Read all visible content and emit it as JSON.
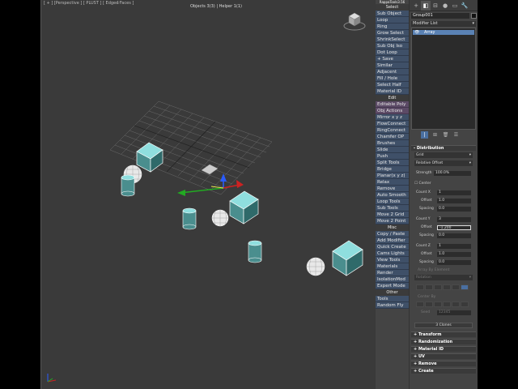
{
  "viewport": {
    "label": "[ + ] [Perspective ] [ PLUST ] [ Edged Faces ]",
    "close_glyph": "☆",
    "stats": "Objects 3(3) | Helper 1(1)"
  },
  "quad_menu": {
    "title": "RappaTools3.56",
    "groups": [
      {
        "header": "Select",
        "items": [
          {
            "label": "Sub Object",
            "style": "blue"
          },
          {
            "label": "Loop",
            "style": "blue"
          },
          {
            "label": "Ring",
            "style": "blue"
          },
          {
            "label": "Grow Select",
            "style": "blue"
          },
          {
            "label": "ShrinkSelect",
            "style": "blue"
          },
          {
            "label": "Sub Obj Iso",
            "style": "blue"
          },
          {
            "label": "Dot Loop",
            "style": "blue"
          },
          {
            "label": "+ Save",
            "style": "blue"
          },
          {
            "label": "Similar",
            "style": "blue"
          },
          {
            "label": "Adjacent",
            "style": "blue"
          },
          {
            "label": "Fill / Hole",
            "style": "blue"
          },
          {
            "label": "Select Half",
            "style": "blue"
          },
          {
            "label": "Material ID",
            "style": "blue"
          }
        ]
      },
      {
        "header": "Edit",
        "items": [
          {
            "label": "Editable Poly",
            "style": "alt"
          },
          {
            "label": "Obj Actions",
            "style": "alt"
          },
          {
            "label": "Mirror  x  y  z",
            "style": "blue"
          },
          {
            "label": "FlowConnect",
            "style": "blue"
          },
          {
            "label": "RingConnect",
            "style": "blue"
          },
          {
            "label": "Chamfer OP",
            "style": "blue"
          },
          {
            "label": "Brushes",
            "style": "blue"
          },
          {
            "label": "Slide",
            "style": "blue"
          },
          {
            "label": "Push",
            "style": "blue"
          },
          {
            "label": "Split Tools",
            "style": "blue"
          },
          {
            "label": "Bridge",
            "style": "blue"
          },
          {
            "label": "Planar(x  y  z)",
            "style": "blue"
          },
          {
            "label": "Relax",
            "style": "blue"
          },
          {
            "label": "Remove",
            "style": "blue"
          },
          {
            "label": "Auto Smooth",
            "style": "blue"
          },
          {
            "label": "Loop Tools",
            "style": "blue"
          },
          {
            "label": "Sub Tools",
            "style": "blue"
          },
          {
            "label": "Move 2 Grid",
            "style": "blue"
          },
          {
            "label": "Move 2 Point",
            "style": "blue"
          }
        ]
      },
      {
        "header": "Misc",
        "items": [
          {
            "label": "Copy / Paste",
            "style": "blue"
          },
          {
            "label": "Add Modifier",
            "style": "blue"
          },
          {
            "label": "Quick Create",
            "style": "blue"
          },
          {
            "label": "Cams Lights",
            "style": "blue"
          },
          {
            "label": "View Tools",
            "style": "blue"
          },
          {
            "label": "Materials",
            "style": "blue"
          },
          {
            "label": "Render",
            "style": "blue"
          },
          {
            "label": "IsolationMod",
            "style": "blue"
          },
          {
            "label": "Expert Mode",
            "style": "blue"
          }
        ]
      },
      {
        "header": "Other",
        "items": [
          {
            "label": "Tools",
            "style": "blue"
          },
          {
            "label": "Random Fly",
            "style": "blue"
          }
        ]
      }
    ]
  },
  "command_panel": {
    "tabs": [
      {
        "icon": "create-icon",
        "glyph": "+"
      },
      {
        "icon": "modify-icon",
        "glyph": "◧"
      },
      {
        "icon": "hierarchy-icon",
        "glyph": "⊟"
      },
      {
        "icon": "motion-icon",
        "glyph": "●"
      },
      {
        "icon": "display-icon",
        "glyph": "▭"
      },
      {
        "icon": "utilities-icon",
        "glyph": "🔧"
      }
    ],
    "object_name": "Group001",
    "modifier_list": "Modifier List",
    "stack_item": "Array",
    "distribution": {
      "title": "Distribution",
      "mode": "Grid",
      "offset_mode": "Relative Offset",
      "strength_label": "Strength",
      "strength": "100.0%",
      "center_label": "Center",
      "count_x_label": "Count X",
      "count_x": "1",
      "offset_x_label": "Offset",
      "offset_x": "1.0",
      "spacing_x_label": "Spacing",
      "spacing_x": "0.0",
      "count_y_label": "Count Y",
      "count_y": "3",
      "offset_y_label": "Offset",
      "offset_y": "-1.200",
      "spacing_y_label": "Spacing",
      "spacing_y": "0.0",
      "count_z_label": "Count Z",
      "count_z": "1",
      "offset_z_label": "Offset",
      "offset_z": "1.0",
      "spacing_z_label": "Spacing",
      "spacing_z": "0.0",
      "array_by_element": "Array By Element",
      "rotation": "Rotation",
      "center_by": "Center By",
      "seed_label": "Seed",
      "seed": "12345",
      "clones": "3 Clones"
    },
    "rollouts": [
      "Transform",
      "Randomization",
      "Material ID",
      "UV",
      "Remove",
      "Create"
    ]
  }
}
